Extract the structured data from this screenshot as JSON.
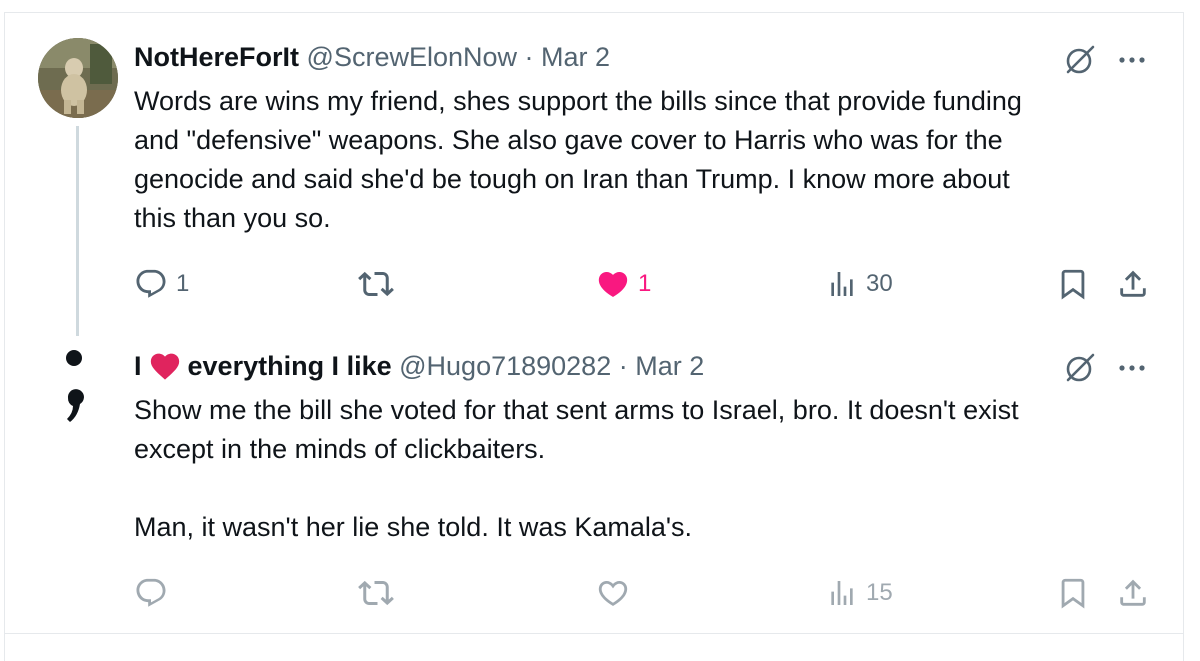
{
  "tweets": [
    {
      "display_name": "NotHereForIt",
      "handle": "@ScrewElonNow",
      "separator": "·",
      "date": "Mar 2",
      "text": "Words are wins my friend, shes support the bills since that provide funding\nand \"defensive\" weapons. She also gave cover to Harris who was for the\ngenocide and said she'd be tough on Iran than Trump. I know more about\nthis than you so.",
      "replies": "1",
      "reposts": "",
      "likes": "1",
      "liked": true,
      "views": "30"
    },
    {
      "display_name_prefix": "I",
      "display_name_suffix": "everything I like",
      "handle": "@Hugo71890282",
      "separator": "·",
      "date": "Mar 2",
      "text": "Show me the bill she voted for that sent arms to Israel, bro. It doesn't exist\nexcept in the minds of clickbaiters.\n\nMan, it wasn't her lie she told. It was Kamala's.",
      "replies": "",
      "reposts": "",
      "likes": "",
      "liked": false,
      "views": "15"
    }
  ],
  "icons": {
    "reply": "reply-icon",
    "repost": "repost-icon",
    "like": "heart-icon",
    "views": "views-icon",
    "bookmark": "bookmark-icon",
    "share": "share-icon",
    "grok": "grok-icon",
    "more": "more-icon"
  },
  "colors": {
    "text": "#0f1419",
    "secondary": "#536471",
    "like_pink": "#f91880",
    "heart_red": "#e0245e",
    "border": "#e6e9ec"
  }
}
